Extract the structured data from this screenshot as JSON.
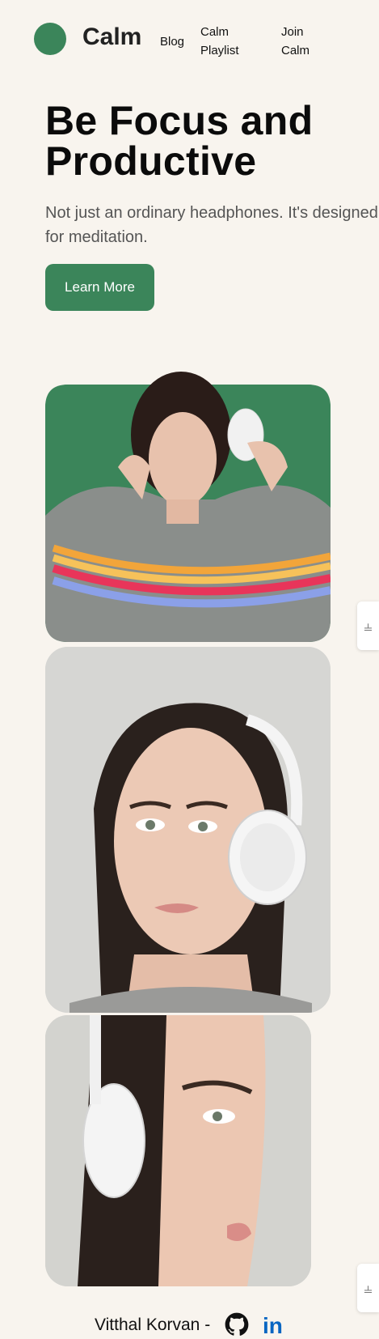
{
  "header": {
    "brand": "Calm",
    "nav": [
      {
        "label": "Blog"
      },
      {
        "label": "Calm\nPlaylist"
      },
      {
        "label": "Join\nCalm"
      }
    ]
  },
  "hero": {
    "title_line1": "Be Focus and",
    "title_line2": "Productive",
    "subtitle_line1": "Not just an ordinary headphones. It's designed",
    "subtitle_line2": "for meditation.",
    "cta_label": "Learn More"
  },
  "images": [
    {
      "name": "woman-with-headphones-green-background"
    },
    {
      "name": "woman-headphones-portrait"
    },
    {
      "name": "woman-headphones-side-view"
    }
  ],
  "side_tabs": [
    {
      "icon": "hotjar-icon"
    },
    {
      "icon": "hotjar-icon"
    }
  ],
  "footer": {
    "author": "Vitthal Korvan -",
    "links": [
      {
        "icon": "github-icon"
      },
      {
        "icon": "linkedin-icon",
        "label": "in"
      }
    ]
  },
  "colors": {
    "accent": "#3b855a",
    "background": "#f8f4ee",
    "linkedin": "#0a66c2"
  }
}
